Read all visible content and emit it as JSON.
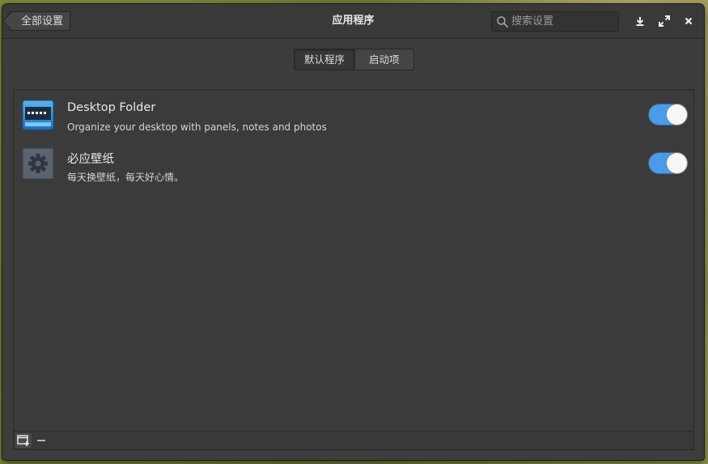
{
  "header": {
    "back_label": "全部设置",
    "title": "应用程序",
    "search_placeholder": "搜索设置"
  },
  "tabs": [
    {
      "label": "默认程序",
      "active": true
    },
    {
      "label": "启动项",
      "active": false
    }
  ],
  "startup_apps": [
    {
      "name": "Desktop Folder",
      "description": "Organize your desktop with panels, notes and photos",
      "icon": "desktop-folder-icon",
      "enabled": true
    },
    {
      "name": "必应壁纸",
      "description": "每天换壁纸，每天好心情。",
      "icon": "gear-icon",
      "enabled": true
    }
  ],
  "toolbar": {
    "add_icon": "add-window-icon",
    "remove_icon": "minus-icon"
  },
  "colors": {
    "accent": "#4a9be8",
    "window_bg": "#3d3d3d"
  }
}
